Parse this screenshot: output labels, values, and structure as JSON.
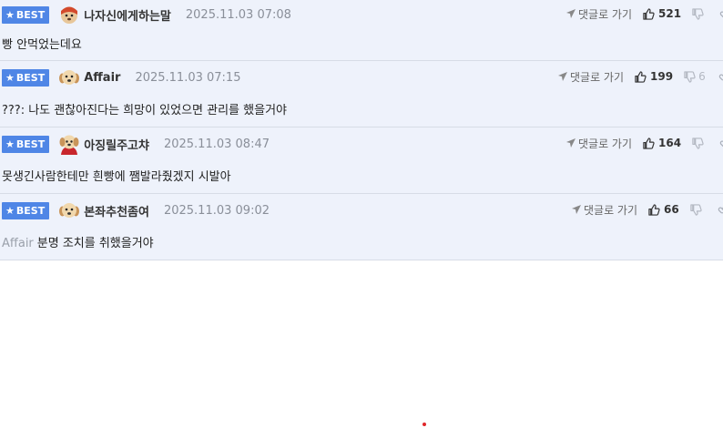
{
  "comments": [
    {
      "badge": "BEST",
      "nickname": "나자신에게하는말",
      "date": "2025.11.03 07:08",
      "text": "빵 안먹었는데요",
      "mention": "",
      "reply_label": "댓글로 가기",
      "likes": "521",
      "dislikes": ""
    },
    {
      "badge": "BEST",
      "nickname": "Affair",
      "date": "2025.11.03 07:15",
      "text": "???: 나도 괜찮아진다는 희망이 있었으면 관리를 했을거야",
      "mention": "",
      "reply_label": "댓글로 가기",
      "likes": "199",
      "dislikes": "6"
    },
    {
      "badge": "BEST",
      "nickname": "아징릴주고챠",
      "date": "2025.11.03 08:47",
      "text": "못생긴사람한테만 흰빵에 쨈발라줬겠지 시발아",
      "mention": "",
      "reply_label": "댓글로 가기",
      "likes": "164",
      "dislikes": ""
    },
    {
      "badge": "BEST",
      "nickname": "본좌추천좀여",
      "date": "2025.11.03 09:02",
      "text": "분명 조치를 취했을거야",
      "mention": "Affair",
      "reply_label": "댓글로 가기",
      "likes": "66",
      "dislikes": ""
    }
  ],
  "colors": {
    "badge": "#4f86e6",
    "row_background": "#eef2fb",
    "accent_dot": "#e0262a"
  },
  "icons": {
    "badge": "star-icon",
    "reply": "arrow-icon",
    "like": "thumb-up-icon",
    "dislike": "thumb-down-icon",
    "link": "link-icon"
  }
}
